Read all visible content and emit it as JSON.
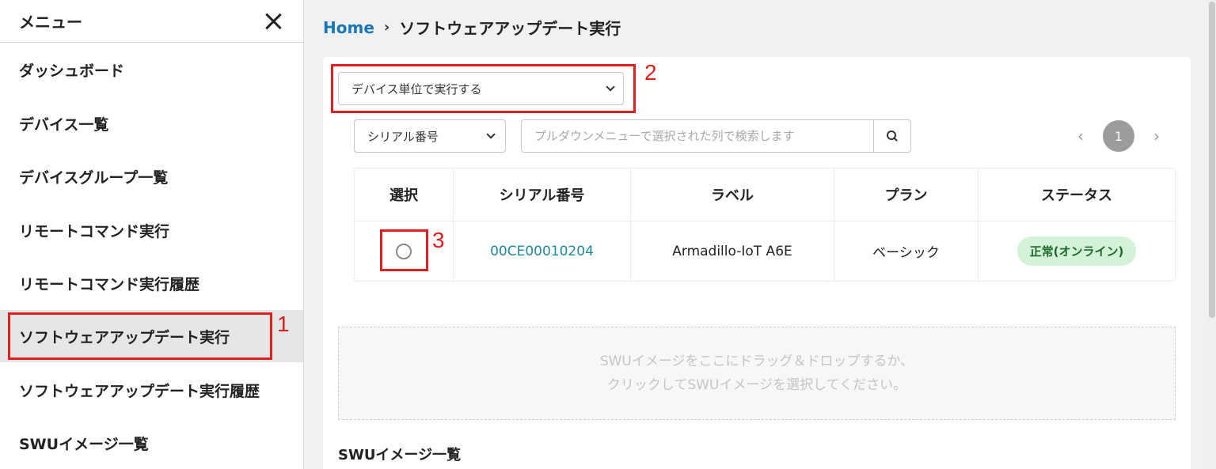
{
  "sidebar": {
    "title": "メニュー",
    "items": [
      {
        "label": "ダッシュボード"
      },
      {
        "label": "デバイス一覧"
      },
      {
        "label": "デバイスグループ一覧"
      },
      {
        "label": "リモートコマンド実行"
      },
      {
        "label": "リモートコマンド実行履歴"
      },
      {
        "label": "ソフトウェアアップデート実行",
        "active": true
      },
      {
        "label": "ソフトウェアアップデート実行履歴"
      },
      {
        "label": "SWUイメージ一覧"
      }
    ]
  },
  "breadcrumb": {
    "home": "Home",
    "separator": "›",
    "current": "ソフトウェアアップデート実行"
  },
  "execution_mode": {
    "selected": "デバイス単位で実行する"
  },
  "search": {
    "column_selected": "シリアル番号",
    "placeholder": "プルダウンメニューで選択された列で検索します"
  },
  "pagination": {
    "prev": "‹",
    "current": "1",
    "next": "›"
  },
  "table": {
    "headers": [
      "選択",
      "シリアル番号",
      "ラベル",
      "プラン",
      "ステータス"
    ],
    "rows": [
      {
        "serial": "00CE00010204",
        "label": "Armadillo-IoT A6E",
        "plan": "ベーシック",
        "status": "正常(オンライン)"
      }
    ]
  },
  "dropzone": {
    "line1": "SWUイメージをここにドラッグ＆ドロップするか、",
    "line2": "クリックしてSWUイメージを選択してください。"
  },
  "swu_section": {
    "title": "SWUイメージ一覧"
  },
  "annotations": [
    "1",
    "2",
    "3"
  ],
  "colors": {
    "link": "#1976b8",
    "annotation": "#e0201f",
    "status_bg": "#d3f2d7"
  }
}
